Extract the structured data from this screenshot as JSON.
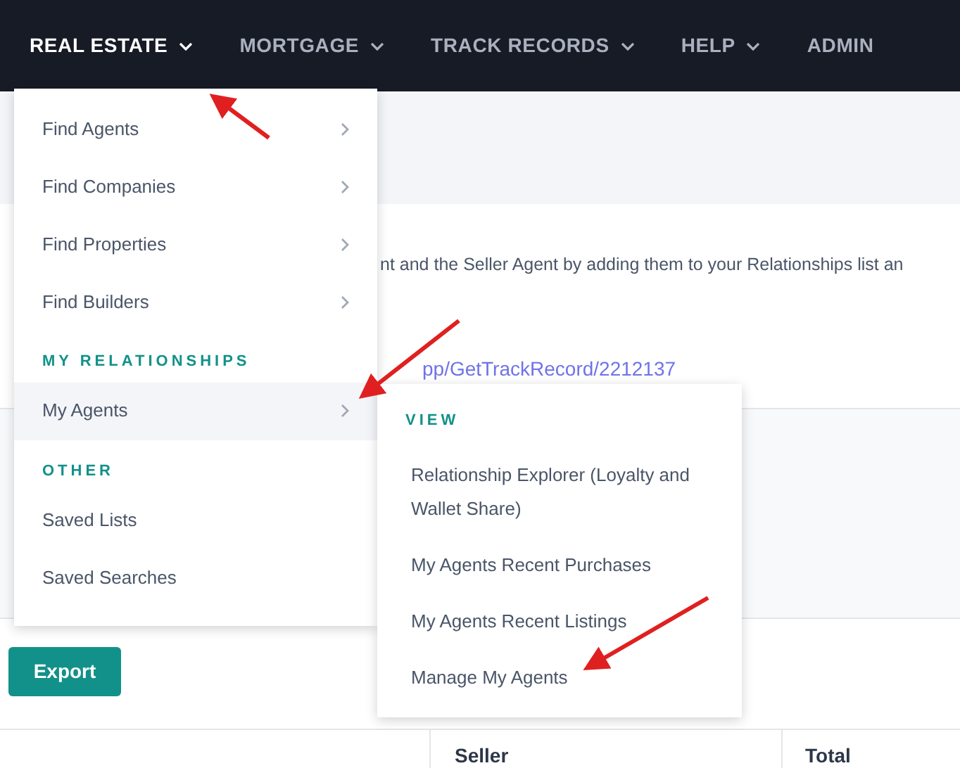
{
  "navbar": {
    "items": [
      {
        "label": "REAL ESTATE",
        "caret": true,
        "selected": true
      },
      {
        "label": "MORTGAGE",
        "caret": true,
        "selected": false
      },
      {
        "label": "TRACK RECORDS",
        "caret": true,
        "selected": false
      },
      {
        "label": "HELP",
        "caret": true,
        "selected": false
      },
      {
        "label": "ADMIN",
        "caret": false,
        "selected": false
      }
    ]
  },
  "background": {
    "description": "nt and the Seller Agent by adding them to your Relationships list an",
    "link": "pp/GetTrackRecord/2212137",
    "export_button": "Export",
    "table_headers": [
      "Seller",
      "Total"
    ]
  },
  "dropdown": {
    "items": [
      {
        "kind": "item",
        "label": "Find Agents",
        "selected": false
      },
      {
        "kind": "item",
        "label": "Find Companies",
        "selected": false
      },
      {
        "kind": "item",
        "label": "Find Properties",
        "selected": false
      },
      {
        "kind": "item",
        "label": "Find Builders",
        "selected": false
      },
      {
        "kind": "header",
        "label": "MY RELATIONSHIPS"
      },
      {
        "kind": "item",
        "label": "My Agents",
        "selected": true
      },
      {
        "kind": "header",
        "label": "OTHER"
      },
      {
        "kind": "link",
        "label": "Saved Lists"
      },
      {
        "kind": "link",
        "label": "Saved Searches"
      }
    ]
  },
  "submenu": {
    "header": "VIEW",
    "items": [
      "Relationship Explorer (Loyalty and Wallet Share)",
      "My Agents Recent Purchases",
      "My Agents Recent Listings",
      "Manage My Agents"
    ]
  }
}
